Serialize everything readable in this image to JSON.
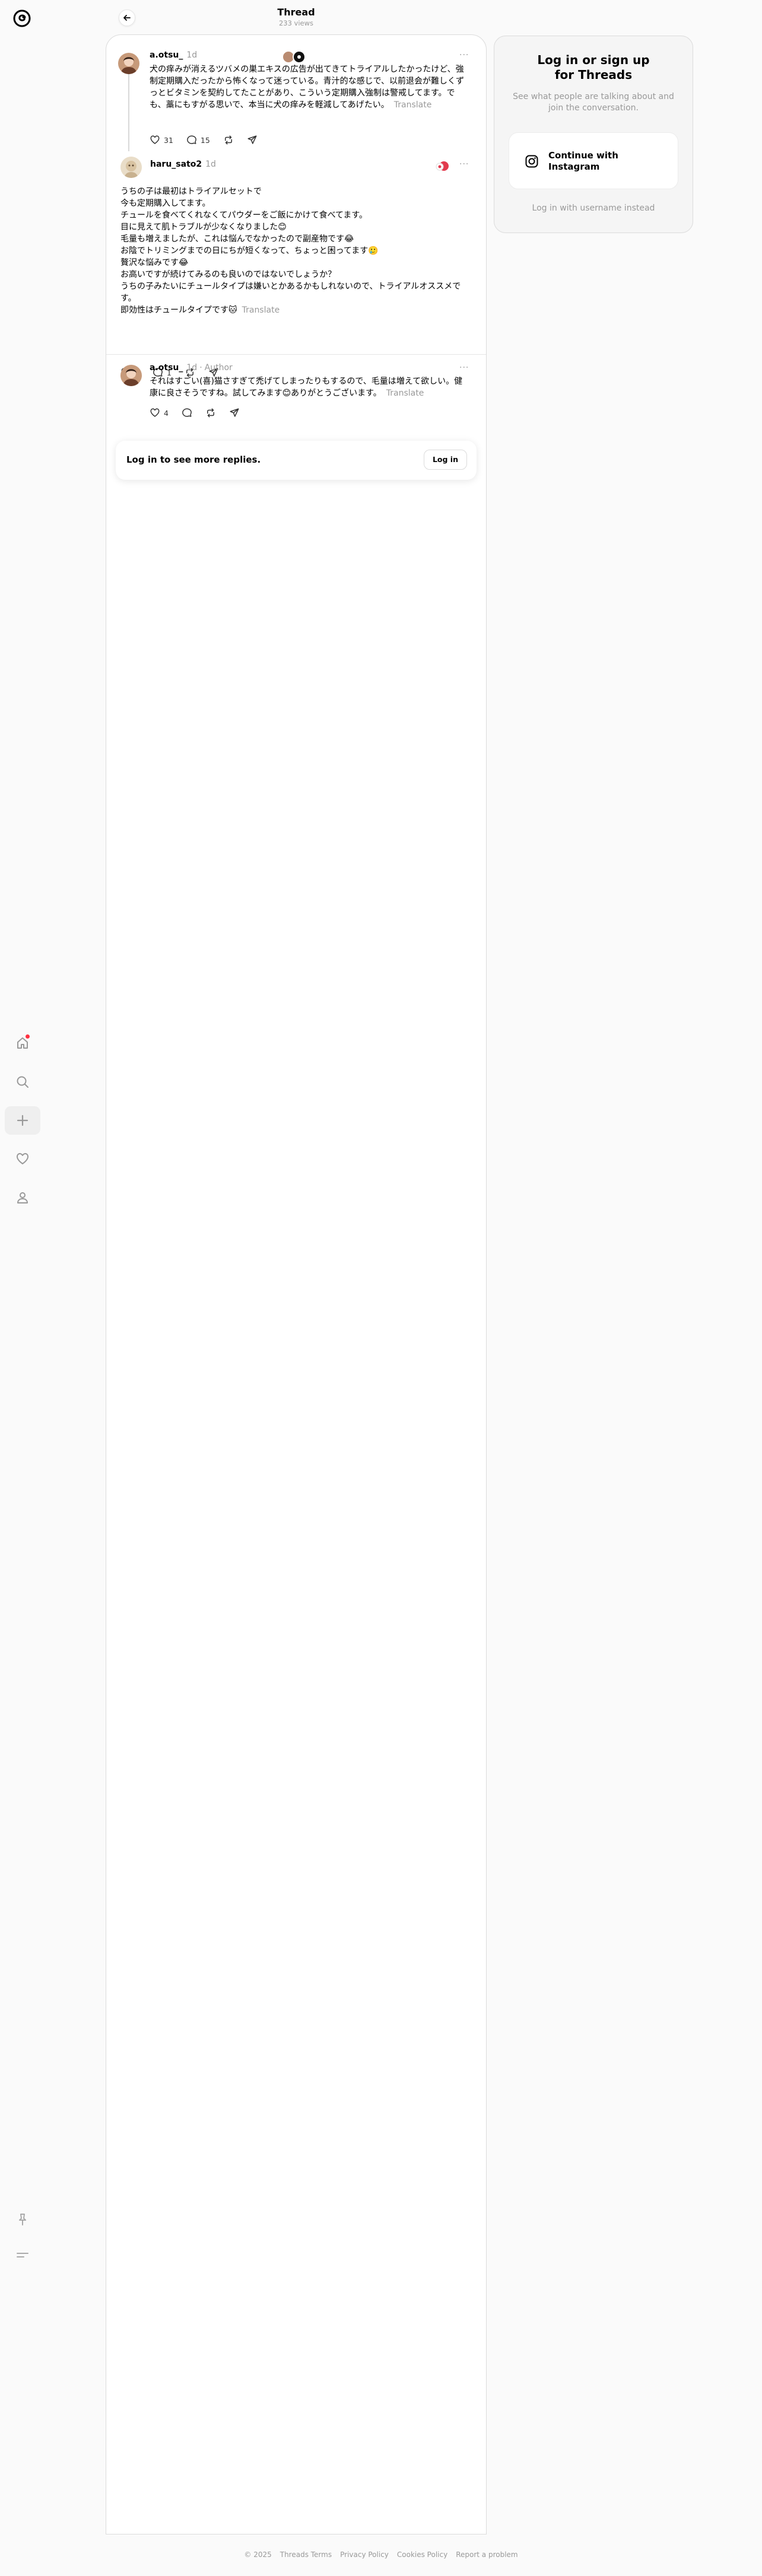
{
  "header": {
    "title": "Thread",
    "views": "233 views"
  },
  "nav": {
    "logo_icon": "threads-logo-icon",
    "items": [
      "home-icon",
      "search-icon",
      "create-icon",
      "activity-icon",
      "profile-icon"
    ],
    "bottom": [
      "pin-icon",
      "menu-icon"
    ],
    "notification_color": "#ff3040"
  },
  "posts": [
    {
      "username": "a.otsu_",
      "time": "1d",
      "text": "犬の痒みが消えるツバメの巣エキスの広告が出てきてトライアルしたかったけど、強制定期購入だったから怖くなって迷っている。青汁的な感じで、以前退会が難しくずっとビタミンを契約してたことがあり、こういう定期購入強制は警戒してます。でも、藁にもすがる思いで、本当に犬の痒みを軽減してあげたい。",
      "translate": "Translate",
      "likes": "31",
      "replies": "15"
    },
    {
      "username": "haru_sato2",
      "time": "1d",
      "lines": [
        "うちの子は最初はトライアルセットで",
        "今も定期購入してます。",
        "チュールを食べてくれなくてパウダーをご飯にかけて食べてます。",
        "目に見えて肌トラブルが少なくなりました😊",
        "毛量も増えましたが、これは悩んでなかったので副産物です😂",
        "お陰でトリミングまでの日にちが短くなって、ちょっと困ってます🥲",
        "贅沢な悩みです😂",
        "お高いですが続けてみるのも良いのではないでしょうか？",
        "うちの子みたいにチュールタイプは嫌いとかあるかもしれないので、トライアルオススメです。",
        "即効性はチュールタイプです🐱"
      ],
      "translate": "Translate",
      "likes": "2",
      "replies": "1"
    },
    {
      "username": "a.otsu_",
      "time": "1d",
      "author_badge": "Author",
      "text": "それはすごい(喜)猫さすぎて禿げてしまったりもするので、毛量は増えて欲しい。健康に良さそうですね。試してみます😊ありがとうございます。",
      "translate": "Translate",
      "likes": "4"
    }
  ],
  "login_prompt": {
    "text": "Log in to see more replies.",
    "button": "Log in"
  },
  "side_panel": {
    "title": "Log in or sign up for Threads",
    "description": "See what people are talking about and join the conversation.",
    "instagram_button": "Continue with Instagram",
    "username_link": "Log in with username instead"
  },
  "footer": [
    "© 2025",
    "Threads Terms",
    "Privacy Policy",
    "Cookies Policy",
    "Report a problem"
  ]
}
